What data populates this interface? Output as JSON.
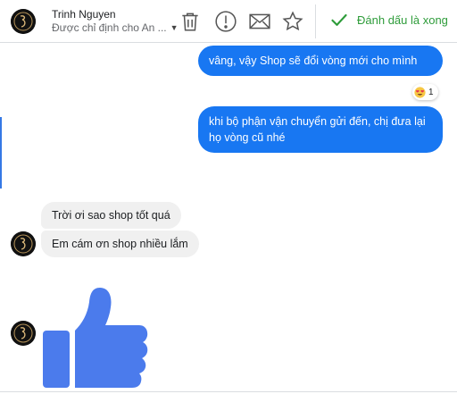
{
  "header": {
    "contact_name": "Trinh Nguyen",
    "assigned_to": "Được chỉ định cho An ...",
    "mark_done_label": "Đánh dấu là xong",
    "icons": [
      "avatar",
      "trash-icon",
      "alert-icon",
      "mail-icon",
      "star-icon",
      "check-icon"
    ]
  },
  "messages": [
    {
      "direction": "outgoing",
      "text": "vâng, vậy Shop sẽ đổi vòng mới cho mình"
    },
    {
      "direction": "outgoing",
      "text": "khi bộ phận vận chuyển gửi đến, chị đưa lại họ vòng cũ nhé"
    },
    {
      "direction": "incoming",
      "text": "Trời ơi sao shop tốt quá"
    },
    {
      "direction": "incoming",
      "text": "Em cám ơn shop nhiều lắm"
    },
    {
      "direction": "incoming",
      "text": "",
      "sticker": "thumbs-up"
    }
  ],
  "reaction": {
    "emoji": "heart-eyes",
    "count": "1"
  },
  "colors": {
    "outgoing_bubble": "#1877f2",
    "incoming_bubble": "#f0f0f0",
    "done_green": "#2e9c3a",
    "like_blue": "#4b7bec"
  }
}
